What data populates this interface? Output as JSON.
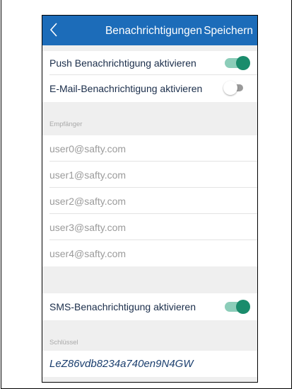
{
  "header": {
    "back_icon": "chevron-left-icon",
    "title": "Benachrichtigungen",
    "save_label": "Speichern"
  },
  "push": {
    "label": "Push Benachrichtigung aktivieren",
    "enabled": true
  },
  "email_notif": {
    "label": "E-Mail-Benachrichtigung aktivieren",
    "enabled": false
  },
  "recipients": {
    "header": "Empfänger",
    "items": [
      "user0@safty.com",
      "user1@safty.com",
      "user2@safty.com",
      "user3@safty.com",
      "user4@safty.com"
    ]
  },
  "sms": {
    "label": "SMS-Benachrichtigung aktivieren",
    "enabled": true
  },
  "key": {
    "header": "Schlüssel",
    "value": "LeZ86vdb8234a740en9N4GW"
  },
  "colors": {
    "nav_bar": "#1c6cb9",
    "toggle_on_knob": "#1a8c6c",
    "toggle_on_track": "#8ccdb9",
    "toggle_off_track": "#9a9a9a",
    "background": "#efefef"
  }
}
